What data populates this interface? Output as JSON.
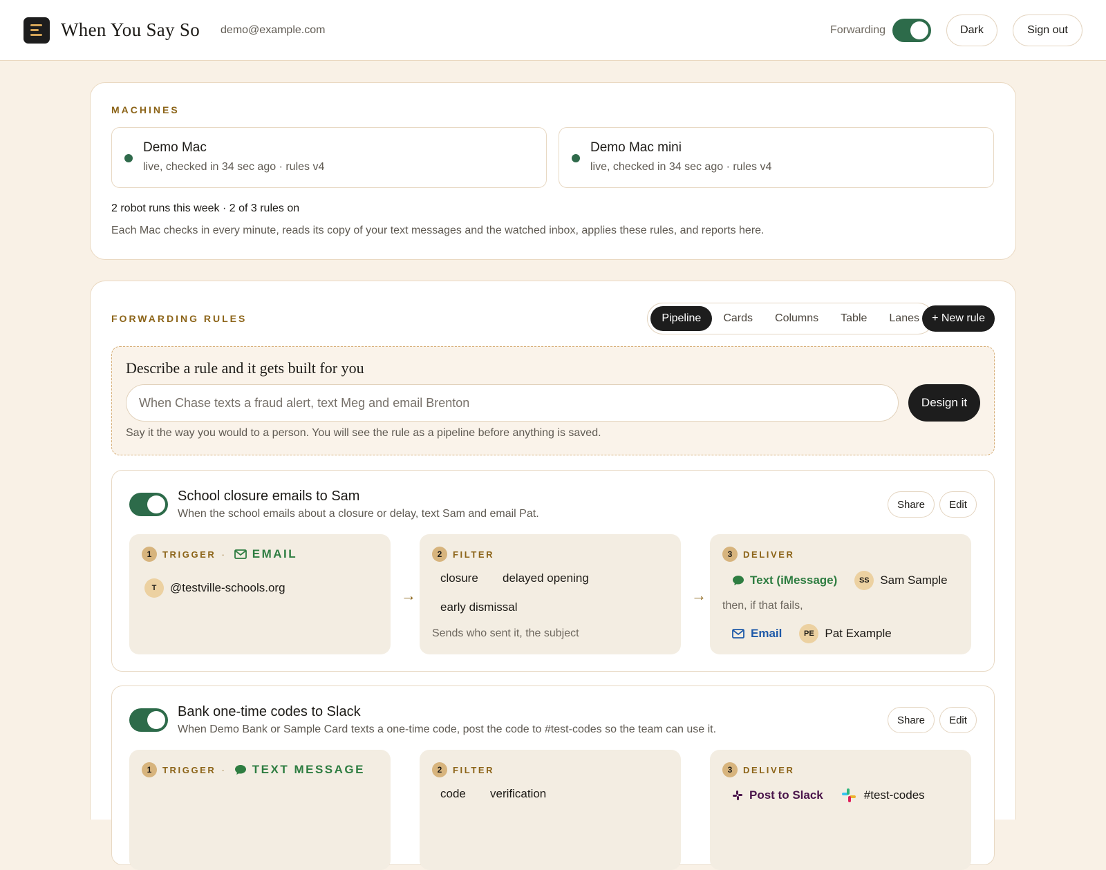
{
  "header": {
    "app_title": "When You Say So",
    "user_email": "demo@example.com",
    "forwarding_label": "Forwarding",
    "forwarding_on": true,
    "theme_button": "Dark",
    "sign_out_button": "Sign out"
  },
  "machines": {
    "section_label": "MACHINES",
    "items": [
      {
        "name": "Demo Mac",
        "status": "live, checked in 34 sec ago · rules v4"
      },
      {
        "name": "Demo Mac mini",
        "status": "live, checked in 34 sec ago · rules v4"
      }
    ],
    "summary": "2 robot runs this week · 2 of 3 rules on",
    "explanation": "Each Mac checks in every minute, reads its copy of your text messages and the watched inbox, applies these rules, and reports here."
  },
  "rules_section": {
    "section_label": "FORWARDING RULES",
    "views": [
      "Pipeline",
      "Cards",
      "Columns",
      "Table",
      "Lanes"
    ],
    "active_view": "Pipeline",
    "new_rule_button": "+ New rule",
    "describe": {
      "title": "Describe a rule and it gets built for you",
      "placeholder": "When Chase texts a fraud alert, text Meg and email Brenton",
      "design_button": "Design it",
      "hint": "Say it the way you would to a person. You will see the rule as a pipeline before anything is saved."
    }
  },
  "rules": [
    {
      "enabled": true,
      "title": "School closure emails to Sam",
      "description": "When the school emails about a closure or delay, text Sam and email Pat.",
      "share_button": "Share",
      "edit_button": "Edit",
      "trigger": {
        "num": "1",
        "label": "TRIGGER",
        "sep": "·",
        "type": "EMAIL",
        "avatar": "T",
        "source": "@testville-schools.org"
      },
      "filter": {
        "num": "2",
        "label": "FILTER",
        "keywords": [
          "closure",
          "delayed opening",
          "early dismissal"
        ],
        "note": "Sends who sent it, the subject"
      },
      "deliver": {
        "num": "3",
        "label": "DELIVER",
        "primary": {
          "channel": "Text (iMessage)",
          "avatar": "SS",
          "recipient": "Sam Sample"
        },
        "fallback_text": "then, if that fails,",
        "fallback": {
          "channel": "Email",
          "avatar": "PE",
          "recipient": "Pat Example"
        }
      },
      "arrow": "→"
    },
    {
      "enabled": true,
      "title": "Bank one-time codes to Slack",
      "description": "When Demo Bank or Sample Card texts a one-time code, post the code to #test-codes so the team can use it.",
      "share_button": "Share",
      "edit_button": "Edit",
      "trigger": {
        "num": "1",
        "label": "TRIGGER",
        "sep": "·",
        "type": "TEXT MESSAGE"
      },
      "filter": {
        "num": "2",
        "label": "FILTER",
        "keywords": [
          "code",
          "verification"
        ]
      },
      "deliver": {
        "num": "3",
        "label": "DELIVER",
        "channel": "Post to Slack",
        "recipient": "#test-codes"
      }
    }
  ],
  "icons": {
    "menu": "menu-icon",
    "email": "email-icon",
    "message": "message-icon",
    "slack": "slack-icon"
  },
  "colors": {
    "accent_green": "#2d6b4a",
    "label_gold": "#8c6418",
    "text_message_green": "#2e7d41",
    "email_blue": "#1f5aa8",
    "slack_purple": "#4a154b",
    "page_bg": "#f9f1e6"
  }
}
